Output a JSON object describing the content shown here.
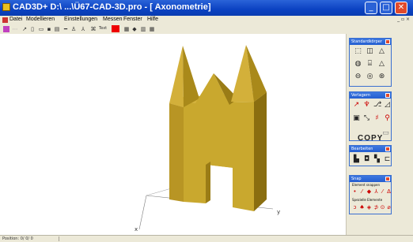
{
  "window": {
    "title": "CAD3D+    D:\\ ...\\Ü67-CAD-3D.pro - [ Axonometrie]",
    "minimize": "_",
    "maximize": "□",
    "close": "✕"
  },
  "menu": {
    "items": [
      "Datei",
      "Modellieren",
      "Einstellungen",
      "Messen",
      "Fenster",
      "Hilfe"
    ],
    "right_controls": "_ ▫ ×"
  },
  "toolbar": {
    "text_button": "Text"
  },
  "viewport": {
    "axis_y_label": "y",
    "axis_x_label": "x"
  },
  "palettes": {
    "standard_bodies": {
      "title": "Standardkörper"
    },
    "transform": {
      "title": "Verlagern",
      "copy_label": "COPY"
    },
    "edit": {
      "title": "Bearbeiten"
    },
    "snap": {
      "title": "Snap",
      "snap_elements_label": "Element snappen",
      "special_elements_label": "Spezielle Elemente"
    }
  },
  "status": {
    "position_text": "Position:  0/  0/  0"
  },
  "colors": {
    "titlebar": "#0b42c2",
    "chrome": "#ece9d8",
    "model_face": "#c9a82e",
    "model_dark": "#8a6e10"
  }
}
